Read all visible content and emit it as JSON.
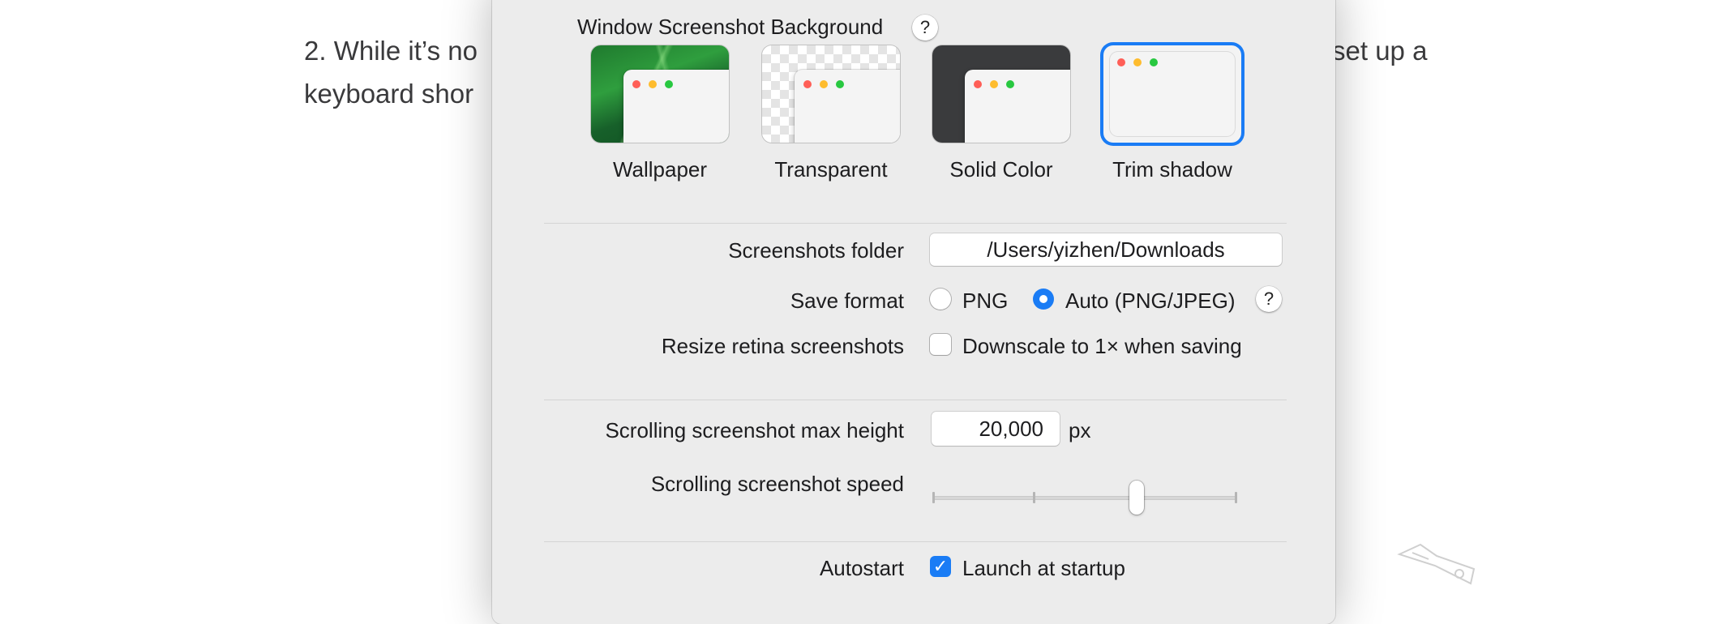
{
  "background": {
    "line1_left": "2. While it’s no",
    "line1_right": "set up a",
    "line2_left": "keyboard shor"
  },
  "dialog": {
    "window_bg_title": "Window Screenshot Background",
    "help_glyph": "?",
    "thumbnails": [
      {
        "label": "Wallpaper",
        "selected": false
      },
      {
        "label": "Transparent",
        "selected": false
      },
      {
        "label": "Solid Color",
        "selected": false
      },
      {
        "label": "Trim shadow",
        "selected": true
      }
    ],
    "screenshots_folder": {
      "label": "Screenshots folder",
      "value": "/Users/yizhen/Downloads"
    },
    "save_format": {
      "label": "Save format",
      "options": [
        {
          "label": "PNG",
          "selected": false
        },
        {
          "label": "Auto (PNG/JPEG)",
          "selected": true
        }
      ]
    },
    "resize_retina": {
      "label": "Resize retina screenshots",
      "checkbox_label": "Downscale to 1× when saving",
      "checked": false
    },
    "scroll_max_height": {
      "label": "Scrolling screenshot max height",
      "value": "20,000",
      "unit": "px"
    },
    "scroll_speed": {
      "label": "Scrolling screenshot speed",
      "level_fraction": 0.67,
      "ticks": 4
    },
    "autostart": {
      "label": "Autostart",
      "checkbox_label": "Launch at startup",
      "checked": true
    },
    "accent_color": "#1a7cf5"
  }
}
